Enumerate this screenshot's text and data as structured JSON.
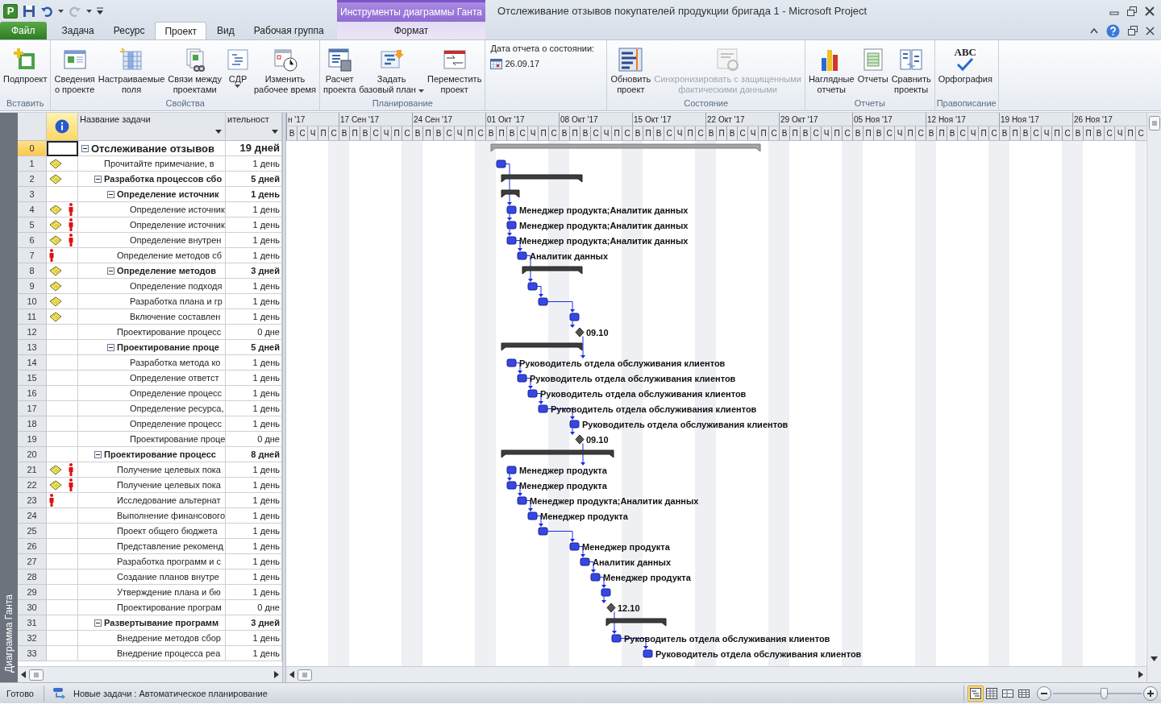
{
  "app": {
    "letter": "P"
  },
  "quick_access": {
    "undo_enabled": true,
    "redo_enabled": false
  },
  "window": {
    "title": "Отслеживание отзывов покупателей продукции бригада 1  -  Microsoft Project",
    "context_label": "Инструменты диаграммы Ганта"
  },
  "tabs": [
    {
      "label": "Файл",
      "kind": "file",
      "selected": false
    },
    {
      "label": "Задача",
      "kind": "tab",
      "selected": false
    },
    {
      "label": "Ресурс",
      "kind": "tab",
      "selected": false
    },
    {
      "label": "Проект",
      "kind": "tab",
      "selected": true
    },
    {
      "label": "Вид",
      "kind": "tab",
      "selected": false
    },
    {
      "label": "Рабочая группа",
      "kind": "tab",
      "selected": false
    },
    {
      "label": "Формат",
      "kind": "context",
      "selected": false
    }
  ],
  "ribbon": {
    "groups": [
      {
        "kind": "buttons",
        "label": "Вставить",
        "buttons": [
          {
            "lines": [
              "Подпроект"
            ],
            "dropdown": false,
            "disabled": false
          }
        ]
      },
      {
        "kind": "buttons",
        "label": "Свойства",
        "buttons": [
          {
            "lines": [
              "Сведения",
              "о проекте"
            ],
            "dropdown": false,
            "disabled": false
          },
          {
            "lines": [
              "Настраиваемые",
              "поля"
            ],
            "dropdown": false,
            "disabled": false
          },
          {
            "lines": [
              "Связи между",
              "проектами"
            ],
            "dropdown": false,
            "disabled": false
          },
          {
            "lines": [
              "СДР"
            ],
            "dropdown": true,
            "disabled": false
          },
          {
            "lines": [
              "Изменить",
              "рабочее время"
            ],
            "dropdown": false,
            "disabled": false
          }
        ]
      },
      {
        "kind": "buttons",
        "label": "Планирование",
        "buttons": [
          {
            "lines": [
              "Расчет",
              "проекта"
            ],
            "dropdown": false,
            "disabled": false
          },
          {
            "lines": [
              "Задать",
              "базовый план"
            ],
            "dropdown": true,
            "disabled": false
          },
          {
            "lines": [
              "Переместить",
              "проект"
            ],
            "dropdown": false,
            "disabled": false
          }
        ]
      },
      {
        "kind": "status_date",
        "label": "Дата отчета о состоянии:",
        "value": "26.09.17"
      },
      {
        "kind": "buttons",
        "label": "Состояние",
        "buttons": [
          {
            "lines": [
              "Обновить",
              "проект"
            ],
            "dropdown": false,
            "disabled": false
          },
          {
            "lines": [
              "Синхронизировать с защищенными",
              "фактическими данными"
            ],
            "dropdown": false,
            "disabled": true
          }
        ]
      },
      {
        "kind": "buttons",
        "label": "Отчеты",
        "buttons": [
          {
            "lines": [
              "Наглядные",
              "отчеты"
            ],
            "dropdown": false,
            "disabled": false
          },
          {
            "lines": [
              "Отчеты"
            ],
            "dropdown": false,
            "disabled": false
          },
          {
            "lines": [
              "Сравнить",
              "проекты"
            ],
            "dropdown": false,
            "disabled": false
          }
        ]
      },
      {
        "kind": "buttons",
        "label": "Правописание",
        "buttons": [
          {
            "lines": [
              "Орфография"
            ],
            "dropdown": false,
            "disabled": false,
            "icon_text": "ABC"
          }
        ]
      }
    ]
  },
  "side_label": "Диаграмма Ганта",
  "table": {
    "columns": [
      "Название задачи",
      "ительност"
    ]
  },
  "tasks": [
    {
      "id": "0",
      "name": "Отслеживание отзывов",
      "duration": "19 дней",
      "kind": "project_summary",
      "expanded": true,
      "selected": true,
      "note": false,
      "person": false,
      "children": [
        {
          "id": "1",
          "name": "Прочитайте примечание, в",
          "duration": "1 день",
          "kind": "task",
          "selected": false,
          "note": true,
          "person": false
        },
        {
          "id": "2",
          "name": "Разработка процессов сбо",
          "duration": "5 дней",
          "kind": "summary",
          "expanded": true,
          "selected": false,
          "note": true,
          "person": false,
          "children": [
            {
              "id": "3",
              "name": "Определение источник",
              "duration": "1 день",
              "kind": "summary",
              "expanded": true,
              "selected": false,
              "note": false,
              "person": false,
              "children": [
                {
                  "id": "4",
                  "name": "Определение источник",
                  "duration": "1 день",
                  "kind": "task",
                  "selected": false,
                  "note": true,
                  "person": true,
                  "label": "Менеджер продукта;Аналитик данных"
                },
                {
                  "id": "5",
                  "name": "Определение источник",
                  "duration": "1 день",
                  "kind": "task",
                  "selected": false,
                  "note": true,
                  "person": true,
                  "label": "Менеджер продукта;Аналитик данных"
                },
                {
                  "id": "6",
                  "name": "Определение внутрен",
                  "duration": "1 день",
                  "kind": "task",
                  "selected": false,
                  "note": true,
                  "person": true,
                  "label": "Менеджер продукта;Аналитик данных"
                }
              ]
            },
            {
              "id": "7",
              "name": "Определение методов сб",
              "duration": "1 день",
              "kind": "task",
              "selected": false,
              "note": false,
              "person": true,
              "label": "Аналитик данных"
            },
            {
              "id": "8",
              "name": "Определение методов",
              "duration": "3 дней",
              "kind": "summary",
              "expanded": true,
              "selected": false,
              "note": true,
              "person": false,
              "children": [
                {
                  "id": "9",
                  "name": "Определение подходя",
                  "duration": "1 день",
                  "kind": "task",
                  "selected": false,
                  "note": true,
                  "person": false
                },
                {
                  "id": "10",
                  "name": "Разработка плана и гр",
                  "duration": "1 день",
                  "kind": "task",
                  "selected": false,
                  "note": true,
                  "person": false
                },
                {
                  "id": "11",
                  "name": "Включение составлен",
                  "duration": "1 день",
                  "kind": "task",
                  "selected": false,
                  "note": true,
                  "person": false
                }
              ]
            },
            {
              "id": "12",
              "name": "Проектирование процесс",
              "duration": "0 дне",
              "kind": "milestone",
              "selected": false,
              "note": false,
              "person": false,
              "label": "09.10"
            },
            {
              "id": "13",
              "name": "Проектирование проце",
              "duration": "5 дней",
              "kind": "summary",
              "expanded": true,
              "selected": false,
              "note": false,
              "person": false,
              "children": [
                {
                  "id": "14",
                  "name": "Разработка метода ко",
                  "duration": "1 день",
                  "kind": "task",
                  "selected": false,
                  "note": false,
                  "person": false,
                  "label": "Руководитель отдела обслуживания клиентов"
                },
                {
                  "id": "15",
                  "name": "Определение ответст",
                  "duration": "1 день",
                  "kind": "task",
                  "selected": false,
                  "note": false,
                  "person": false,
                  "label": "Руководитель отдела обслуживания клиентов"
                },
                {
                  "id": "16",
                  "name": "Определение процесс",
                  "duration": "1 день",
                  "kind": "task",
                  "selected": false,
                  "note": false,
                  "person": false,
                  "label": "Руководитель отдела обслуживания клиентов"
                },
                {
                  "id": "17",
                  "name": "Определение ресурса,",
                  "duration": "1 день",
                  "kind": "task",
                  "selected": false,
                  "note": false,
                  "person": false,
                  "label": "Руководитель отдела обслуживания клиентов"
                },
                {
                  "id": "18",
                  "name": "Определение процесс",
                  "duration": "1 день",
                  "kind": "task",
                  "selected": false,
                  "note": false,
                  "person": false,
                  "label": "Руководитель отдела обслуживания клиентов"
                },
                {
                  "id": "19",
                  "name": "Проектирование проце",
                  "duration": "0 дне",
                  "kind": "milestone",
                  "selected": false,
                  "note": false,
                  "person": false,
                  "label": "09.10"
                }
              ]
            }
          ]
        },
        {
          "id": "20",
          "name": "Проектирование процесс",
          "duration": "8 дней",
          "kind": "summary",
          "expanded": true,
          "selected": false,
          "note": false,
          "person": false,
          "children": [
            {
              "id": "21",
              "name": "Получение целевых пока",
              "duration": "1 день",
              "kind": "task",
              "selected": false,
              "note": true,
              "person": true,
              "label": "Менеджер продукта"
            },
            {
              "id": "22",
              "name": "Получение целевых пока",
              "duration": "1 день",
              "kind": "task",
              "selected": false,
              "note": true,
              "person": true,
              "label": "Менеджер продукта"
            },
            {
              "id": "23",
              "name": "Исследование альтернат",
              "duration": "1 день",
              "kind": "task",
              "selected": false,
              "note": false,
              "person": true,
              "label": "Менеджер продукта;Аналитик данных"
            },
            {
              "id": "24",
              "name": "Выполнение финансового",
              "duration": "1 день",
              "kind": "task",
              "selected": false,
              "note": false,
              "person": false,
              "label": "Менеджер продукта"
            },
            {
              "id": "25",
              "name": "Проект общего бюджета",
              "duration": "1 день",
              "kind": "task",
              "selected": false,
              "note": false,
              "person": false
            },
            {
              "id": "26",
              "name": "Представление рекоменд",
              "duration": "1 день",
              "kind": "task",
              "selected": false,
              "note": false,
              "person": false,
              "label": "Менеджер продукта"
            },
            {
              "id": "27",
              "name": "Разработка программ и с",
              "duration": "1 день",
              "kind": "task",
              "selected": false,
              "note": false,
              "person": false,
              "label": "Аналитик данных"
            },
            {
              "id": "28",
              "name": "Создание планов внутре",
              "duration": "1 день",
              "kind": "task",
              "selected": false,
              "note": false,
              "person": false,
              "label": "Менеджер продукта"
            },
            {
              "id": "29",
              "name": "Утверждение плана и бю",
              "duration": "1 день",
              "kind": "task",
              "selected": false,
              "note": false,
              "person": false
            },
            {
              "id": "30",
              "name": "Проектирование програм",
              "duration": "0 дне",
              "kind": "milestone",
              "selected": false,
              "note": false,
              "person": false,
              "label": "12.10"
            }
          ]
        },
        {
          "id": "31",
          "name": "Развертывание программ",
          "duration": "3 дней",
          "kind": "summary",
          "expanded": true,
          "selected": false,
          "note": false,
          "person": false,
          "children": [
            {
              "id": "32",
              "name": "Внедрение методов сбор",
              "duration": "1 день",
              "kind": "task",
              "selected": false,
              "note": false,
              "person": false,
              "label": "Руководитель отдела обслуживания клиентов"
            },
            {
              "id": "33",
              "name": "Внедрение процесса реа",
              "duration": "1 день",
              "kind": "task",
              "selected": false,
              "note": false,
              "person": false,
              "label": "Руководитель отдела обслуживания клиентов"
            }
          ]
        }
      ]
    }
  ],
  "gantt": {
    "days": [
      [
        "В",
        "С",
        "Ч",
        "П",
        "С"
      ],
      [
        "В",
        "П",
        "В",
        "С",
        "Ч",
        "П",
        "С"
      ],
      [
        "В",
        "П",
        "В",
        "С",
        "Ч",
        "П",
        "С"
      ],
      [
        "В",
        "П",
        "В",
        "С",
        "Ч",
        "П",
        "С"
      ],
      [
        "В",
        "П",
        "В",
        "С",
        "Ч",
        "П",
        "С"
      ],
      [
        "В",
        "П",
        "В",
        "С",
        "Ч",
        "П",
        "С"
      ],
      [
        "В",
        "П",
        "В",
        "С",
        "Ч",
        "П",
        "С"
      ],
      [
        "В",
        "П",
        "В",
        "С",
        "Ч",
        "П",
        "С"
      ],
      [
        "В",
        "П",
        "В",
        "С",
        "Ч",
        "П",
        "С"
      ],
      [
        "В",
        "П",
        "В",
        "С",
        "Ч",
        "П",
        "С"
      ],
      [
        "В",
        "П",
        "В",
        "С",
        "Ч",
        "П",
        "С"
      ],
      [
        "В",
        "П",
        "В",
        "С",
        "Ч",
        "П",
        "С"
      ]
    ],
    "weeks": [
      "н '17",
      "17 Сен '17",
      "24 Сен '17",
      "01 Окт '17",
      "08 Окт '17",
      "15 Окт '17",
      "22 Окт '17",
      "29 Окт '17",
      "05 Ноя '17",
      "12 Ноя '17",
      "19 Ноя '17",
      "26 Ноя '17"
    ]
  },
  "status_bar": {
    "ready": "Готово",
    "new_tasks": "Новые задачи : Автоматическое планирование",
    "views": [
      {
        "selected": true
      },
      {
        "selected": false
      },
      {
        "selected": false
      },
      {
        "selected": false
      }
    ],
    "zoom": {
      "level": 0.57
    }
  }
}
